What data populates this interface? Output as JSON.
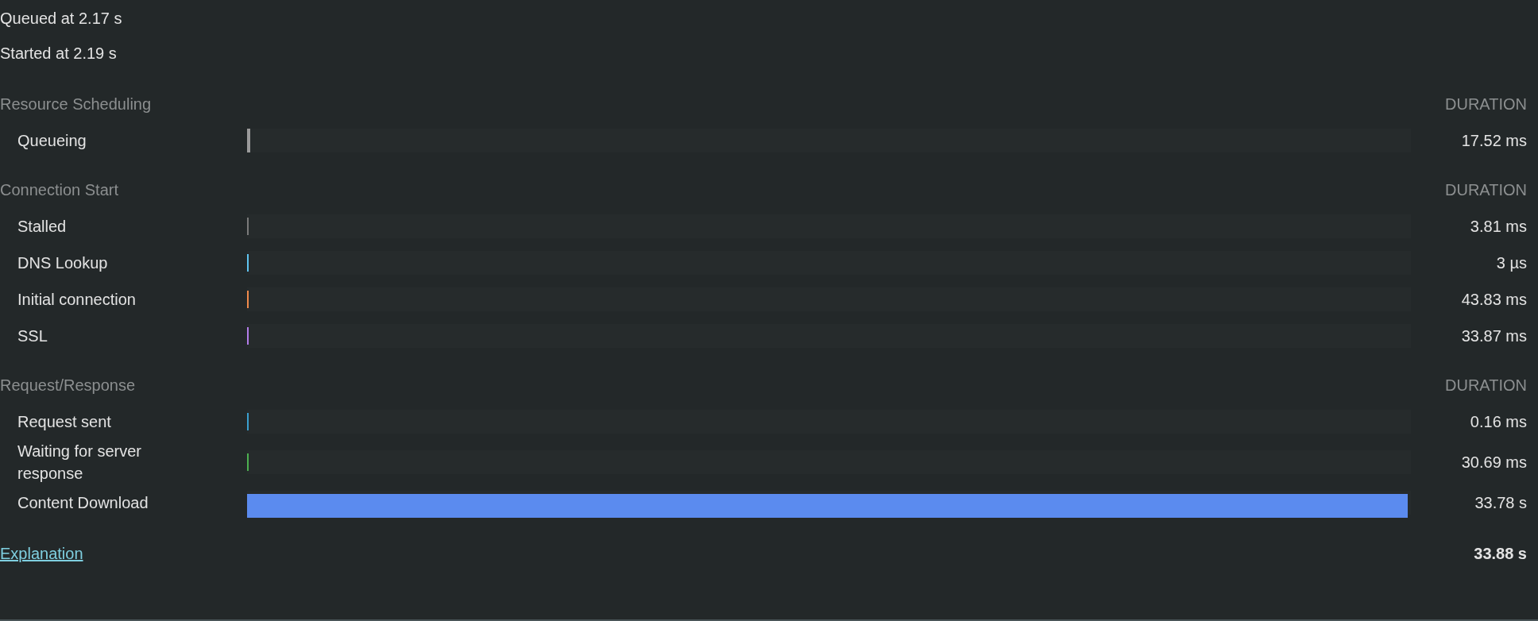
{
  "queued": "Queued at 2.17 s",
  "started": "Started at 2.19 s",
  "sections": [
    {
      "title": "Resource Scheduling",
      "duration_heading": "DURATION",
      "rows": [
        {
          "label": "Queueing",
          "color": "#9b9b9b",
          "level": 0.003,
          "duration": "17.52 ms"
        }
      ]
    },
    {
      "title": "Connection Start",
      "duration_heading": "DURATION",
      "rows": [
        {
          "label": "Stalled",
          "color": "#7a7a7a",
          "level": 0.0015,
          "duration": "3.81 ms"
        },
        {
          "label": "DNS Lookup",
          "color": "#5fc4f0",
          "level": 0.0015,
          "duration": "3 µs"
        },
        {
          "label": "Initial connection",
          "color": "#f08a4b",
          "level": 0.0015,
          "duration": "43.83 ms"
        },
        {
          "label": "SSL",
          "color": "#b27ce8",
          "level": 0.0015,
          "duration": "33.87 ms"
        }
      ]
    },
    {
      "title": "Request/Response",
      "duration_heading": "DURATION",
      "rows": [
        {
          "label": "Request sent",
          "color": "#3a9fcf",
          "level": 0.0015,
          "duration": "0.16 ms"
        },
        {
          "label": "Waiting for server response",
          "color": "#4cb050",
          "level": 0.0015,
          "duration": "30.69 ms"
        },
        {
          "label": "Content Download",
          "color": "#5b8bef",
          "level": 0.997,
          "duration": "33.78 s"
        }
      ]
    }
  ],
  "explanation_link": "Explanation",
  "total": "33.88 s"
}
